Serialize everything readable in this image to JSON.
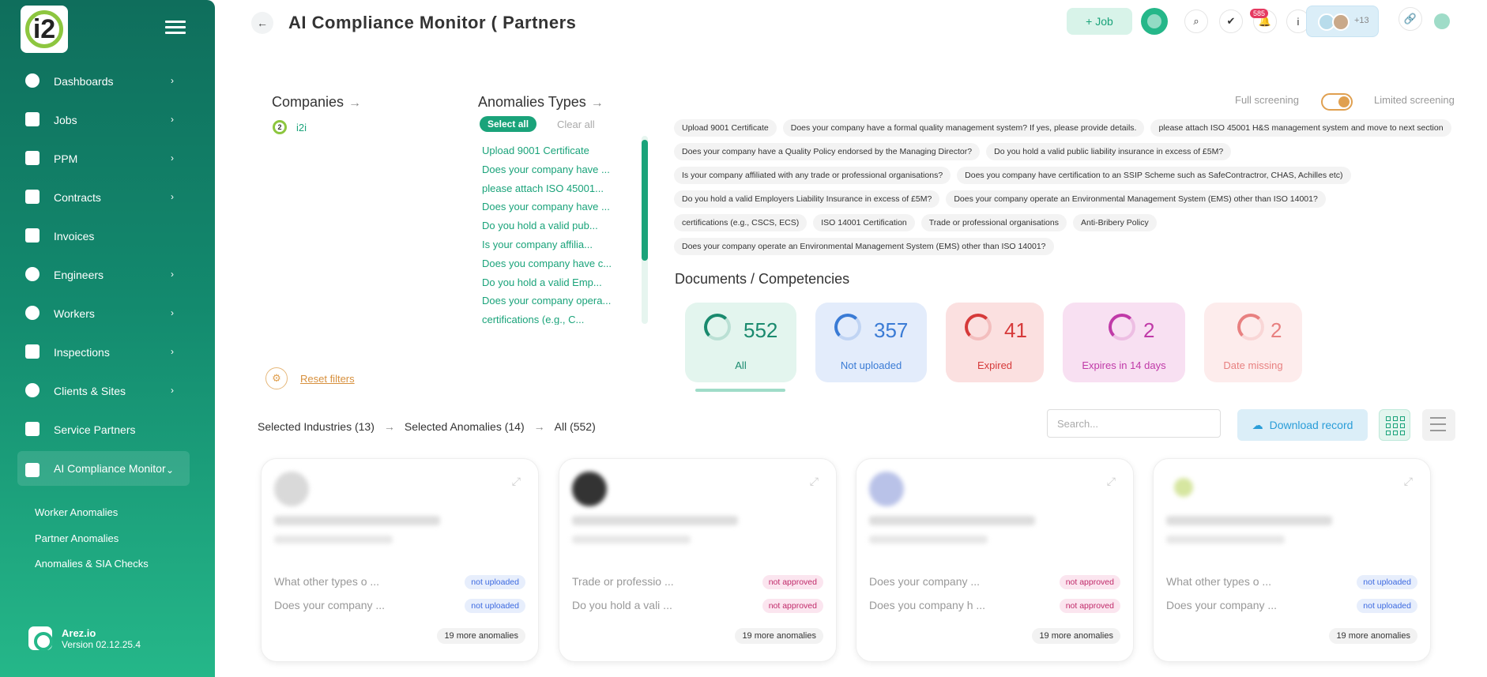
{
  "sidebar": {
    "logo_text": "i2",
    "items": [
      {
        "label": "Dashboards",
        "has_chevron": true
      },
      {
        "label": "Jobs",
        "has_chevron": true
      },
      {
        "label": "PPM",
        "has_chevron": true
      },
      {
        "label": "Contracts",
        "has_chevron": true
      },
      {
        "label": "Invoices",
        "has_chevron": false
      },
      {
        "label": "Engineers",
        "has_chevron": true
      },
      {
        "label": "Workers",
        "has_chevron": true
      },
      {
        "label": "Inspections",
        "has_chevron": true
      },
      {
        "label": "Clients & Sites",
        "has_chevron": true
      },
      {
        "label": "Service Partners",
        "has_chevron": false
      },
      {
        "label": "AI Compliance Monitor",
        "has_chevron": true
      }
    ],
    "sub_items": [
      "Worker Anomalies",
      "Partner Anomalies",
      "Anomalies & SIA Checks"
    ],
    "footer": {
      "name": "Arez.io",
      "version": "Version 02.12.25.4"
    }
  },
  "header": {
    "title": "AI Compliance Monitor ( Partners",
    "job_button": "+ Job",
    "notification_count": "585",
    "avatar_count": "+13"
  },
  "filters": {
    "companies_title": "Companies",
    "companies": [
      "i2i"
    ],
    "anomalies_title": "Anomalies Types",
    "select_all": "Select all",
    "clear_all": "Clear all",
    "anomaly_list": [
      "Upload 9001 Certificate",
      "Does your company have ...",
      "please attach ISO 45001...",
      "Does your company have ...",
      "Do you hold a valid pub...",
      "Is your company affilia...",
      "Does you company have c...",
      "Do you hold a valid Emp...",
      "Does your company opera...",
      "certifications (e.g., C..."
    ],
    "reset": "Reset filters",
    "full_screening": "Full screening",
    "limited_screening": "Limited screening"
  },
  "chips": [
    [
      "Upload 9001 Certificate",
      "Does your company have a formal quality management system? If yes, please provide details.",
      "please attach ISO 45001 H&S management system and move to next section"
    ],
    [
      "Does your company have a Quality Policy endorsed by the Managing Director?",
      "Do you hold a valid public liability insurance in excess of £5M?"
    ],
    [
      "Is your company affiliated with any trade or professional organisations?",
      "Does you company have certification to an SSIP Scheme such as SafeContractror, CHAS, Achilles etc)"
    ],
    [
      "Do you hold a valid Employers Liability Insurance in excess of £5M?",
      "Does your company operate an Environmental Management System (EMS) other than ISO 14001?"
    ],
    [
      "certifications (e.g., CSCS, ECS)",
      "ISO 14001 Certification",
      "Trade or professional organisations",
      "Anti-Bribery Policy"
    ],
    [
      "Does your company operate an Environmental Management System (EMS) other than ISO 14001?"
    ]
  ],
  "documents": {
    "title": "Documents / Competencies",
    "cards": [
      {
        "value": "552",
        "label": "All",
        "bg": "#e3f5ee",
        "color": "#1a8a6e"
      },
      {
        "value": "357",
        "label": "Not uploaded",
        "bg": "#e3ecfb",
        "color": "#3a7bd5"
      },
      {
        "value": "41",
        "label": "Expired",
        "bg": "#fbe0e0",
        "color": "#d63a3a"
      },
      {
        "value": "2",
        "label": "Expires in 14 days",
        "bg": "#f8e0f2",
        "color": "#c03aa8"
      },
      {
        "value": "2",
        "label": "Date missing",
        "bg": "#fdecec",
        "color": "#e88080"
      }
    ]
  },
  "toolbar": {
    "crumb_industries": "Selected Industries (13)",
    "crumb_anomalies": "Selected Anomalies (14)",
    "crumb_all": "All (552)",
    "search_placeholder": "Search...",
    "download": "Download record"
  },
  "partners": [
    {
      "q1": "What other types o ...",
      "s1": "not uploaded",
      "q2": "Does your company ...",
      "s2": "not uploaded",
      "more": "19 more anomalies"
    },
    {
      "q1": "Trade or professio ...",
      "s1": "not approved",
      "q2": "Do you hold a vali ...",
      "s2": "not approved",
      "more": "19 more anomalies"
    },
    {
      "q1": "Does your company ...",
      "s1": "not approved",
      "q2": "Does you company h ...",
      "s2": "not approved",
      "more": "19 more anomalies"
    },
    {
      "q1": "What other types o ...",
      "s1": "not uploaded",
      "q2": "Does your company ...",
      "s2": "not uploaded",
      "more": "19 more anomalies"
    }
  ]
}
